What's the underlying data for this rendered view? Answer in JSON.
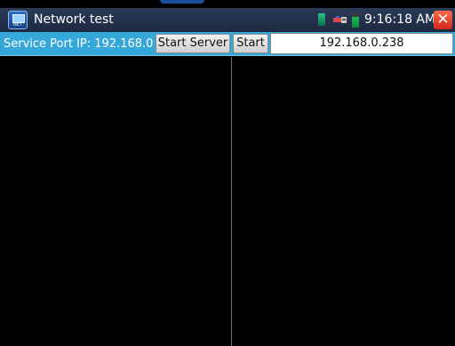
{
  "window": {
    "title": "Network test",
    "app_icon_text": "NET",
    "icons": {
      "app": "network-tester-app-icon",
      "sim": "sim-card-icon",
      "usb": "usb-icon",
      "battery": "battery-icon",
      "close": "close-icon"
    },
    "clock": "9:16:18 AM",
    "close_glyph": "✕"
  },
  "toolbar": {
    "port_label": "Service Port IP: 192.168.0",
    "start_server_label": "Start Server",
    "start_label": "Start",
    "ip_value": "192.168.0.238"
  },
  "colors": {
    "titlebar": "#1c2940",
    "toolbar": "#35a7d9",
    "close_button": "#d2251a",
    "background": "#000000"
  }
}
